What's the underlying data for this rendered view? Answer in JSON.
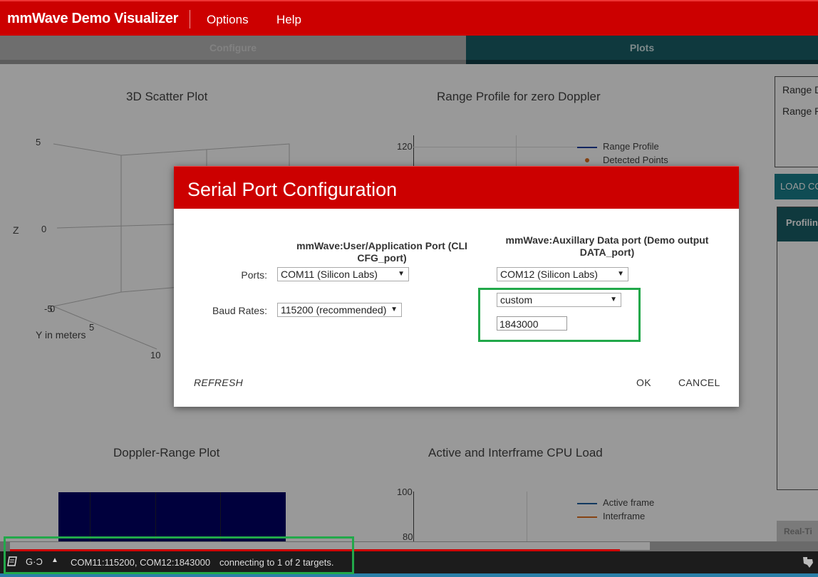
{
  "header": {
    "app_title": "mmWave Demo Visualizer",
    "menu": [
      {
        "label": "Options"
      },
      {
        "label": "Help"
      }
    ]
  },
  "tabs": [
    {
      "label": "Configure",
      "active": false
    },
    {
      "label": "Plots",
      "active": true
    }
  ],
  "plots": {
    "scatter": {
      "title": "3D Scatter Plot",
      "z_axis_label": "Z",
      "y_axis_label": "Y in meters",
      "z_ticks": [
        "5",
        "0",
        "-5"
      ],
      "y_ticks": [
        "0",
        "5",
        "10"
      ]
    },
    "range_profile": {
      "title": "Range Profile for zero Doppler",
      "y_tick_top": "120",
      "legend": [
        "Range Profile",
        "Detected Points"
      ]
    },
    "doppler_range": {
      "title": "Doppler-Range Plot"
    },
    "cpu_load": {
      "title": "Active and Interframe  CPU Load",
      "y_ticks": [
        "100",
        "80"
      ],
      "legend": [
        "Active frame",
        "Interframe"
      ]
    }
  },
  "side_panel": {
    "lines": [
      "Range D",
      "Range P"
    ],
    "load_button": "LOAD CO",
    "profiling_header": "Profilin",
    "realtime_label": "Real-Ti"
  },
  "dialog": {
    "title": "Serial Port Configuration",
    "cli_port_heading": "mmWave:User/Application Port (CLI CFG_port)",
    "data_port_heading_line1": "mmWave:Auxillary Data port (Demo output",
    "data_port_heading_line2": "DATA_port)",
    "ports_label": "Ports:",
    "baud_label": "Baud Rates:",
    "cli_port_value": "COM11 (Silicon Labs)",
    "data_port_value": "COM12 (Silicon Labs)",
    "cli_baud_value": "115200 (recommended)",
    "data_baud_value": "custom",
    "data_baud_custom": "1843000",
    "refresh_label": "REFRESH",
    "ok_label": "OK",
    "cancel_label": "CANCEL"
  },
  "status_bar": {
    "connection_info": "COM11:115200, COM12:1843000",
    "status_message": "connecting to 1 of 2 targets."
  },
  "colors": {
    "brand_red": "#cc0000",
    "tab_teal": "#1a5f68",
    "highlight_green": "#22a84a",
    "legend_blue": "#1f3fa0",
    "legend_orange": "#e07020"
  }
}
